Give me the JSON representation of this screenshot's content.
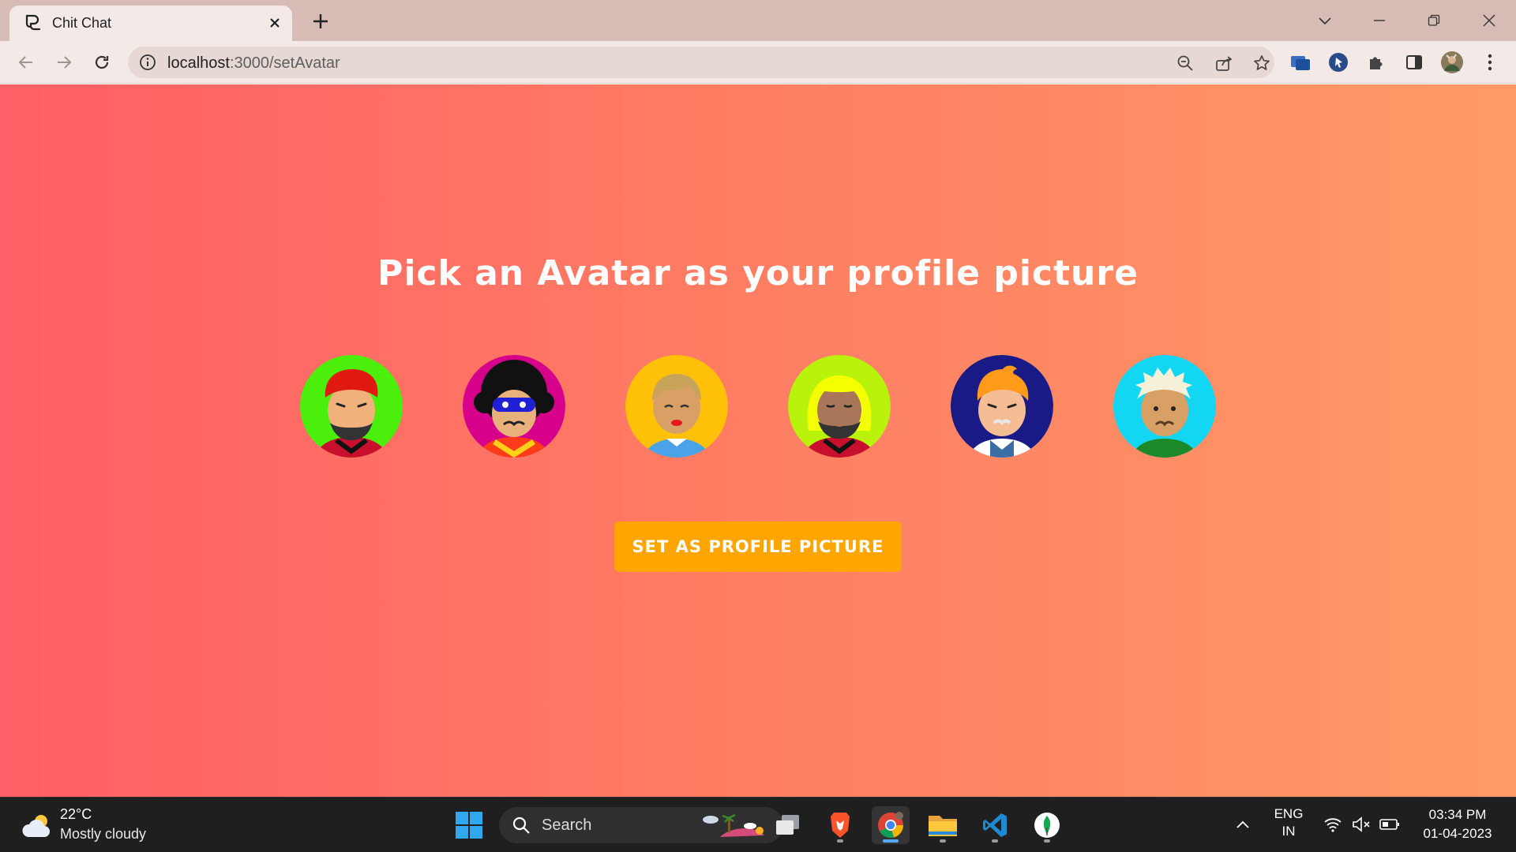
{
  "browser": {
    "tab_title": "Chit Chat",
    "url_host": "localhost",
    "url_path": ":3000/setAvatar"
  },
  "page": {
    "heading": "Pick an Avatar as your profile picture",
    "avatars": [
      {
        "name": "avatar-1",
        "bg": "#4cee0c",
        "hair": "#e01a10",
        "skin": "#f0b27a"
      },
      {
        "name": "avatar-2",
        "bg": "#d6008a",
        "hair": "#111111",
        "skin": "#e8b07a"
      },
      {
        "name": "avatar-3",
        "bg": "#ffc107",
        "hair": "#c8a45a",
        "skin": "#d9a066"
      },
      {
        "name": "avatar-4",
        "bg": "#b9f20a",
        "hair": "#f4ff00",
        "skin": "#a9765a"
      },
      {
        "name": "avatar-5",
        "bg": "#1a1a86",
        "hair": "#ff9a1a",
        "skin": "#f5bd93"
      },
      {
        "name": "avatar-6",
        "bg": "#12d6f2",
        "hair": "#f5f0d8",
        "skin": "#d9a066"
      }
    ],
    "button_label": "SET AS PROFILE PICTURE"
  },
  "taskbar": {
    "weather_temp": "22°C",
    "weather_desc": "Mostly cloudy",
    "search_label": "Search",
    "lang_top": "ENG",
    "lang_bottom": "IN",
    "time": "03:34 PM",
    "date": "01-04-2023"
  },
  "colors": {
    "gradient_start": "#ff5f66",
    "gradient_end": "#ff9a66",
    "button": "#ffa500"
  }
}
